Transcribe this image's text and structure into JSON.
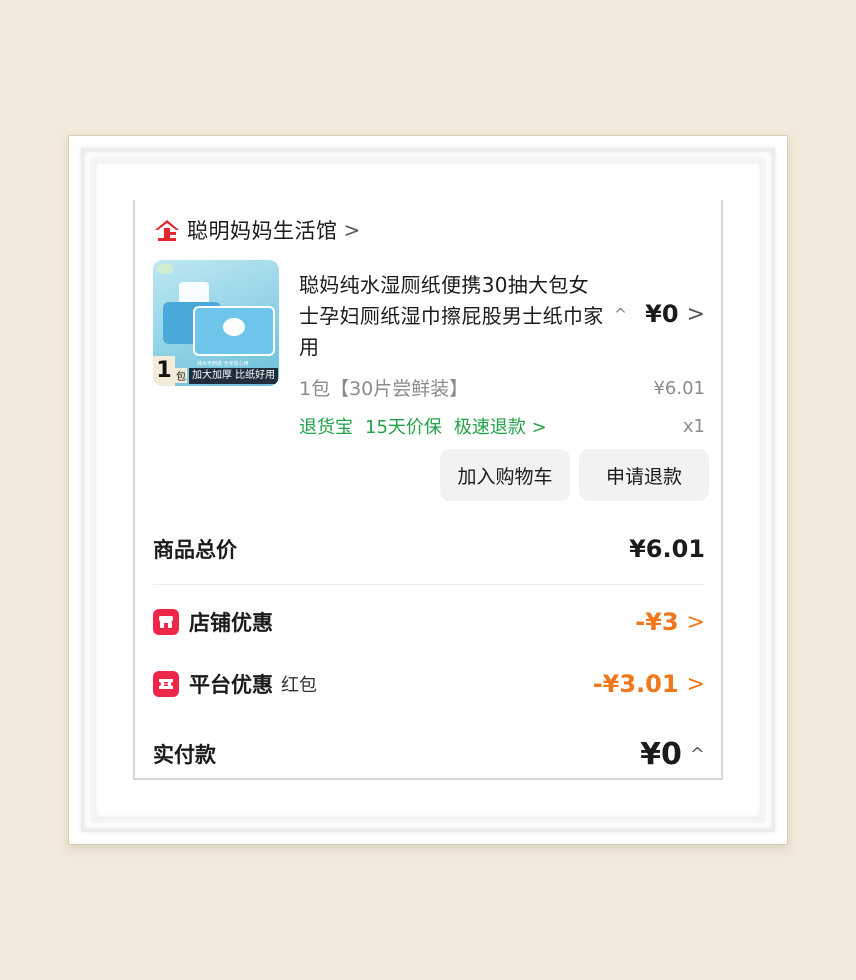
{
  "shop": {
    "name": "聪明妈妈生活馆",
    "arrow": ">"
  },
  "product": {
    "title": "聪妈纯水湿厕纸便携30抽大包女士孕妇厕纸湿巾擦屁股男士纸巾家用",
    "sku": "1包【30片尝鲜装】",
    "price_paid": "¥0",
    "expand_arrow": "^",
    "right_arrow": ">",
    "original_price": "¥6.01",
    "quantity": "x1",
    "services": [
      "退货宝",
      "15天价保",
      "极速退款 >"
    ],
    "thumbnail": {
      "badge_number": "1",
      "badge_unit": "包",
      "tagline": "加大加厚 比纸好用",
      "small_text": "纯水无刺激 全家放心用"
    }
  },
  "actions": {
    "add_to_cart": "加入购物车",
    "request_refund": "申请退款"
  },
  "summary": {
    "total_label": "商品总价",
    "total_value": "¥6.01",
    "shop_discount_label": "店铺优惠",
    "shop_discount_value": "-¥3",
    "platform_discount_label": "平台优惠",
    "platform_discount_sub": "红包",
    "platform_discount_value": "-¥3.01",
    "paid_label": "实付款",
    "paid_value": "¥0",
    "paid_arrow": "^",
    "discount_arrow": ">"
  },
  "colors": {
    "service_green": "#23a249",
    "discount_orange": "#f0771b",
    "icon_red": "#ee2749",
    "shop_red": "#e4262e"
  }
}
